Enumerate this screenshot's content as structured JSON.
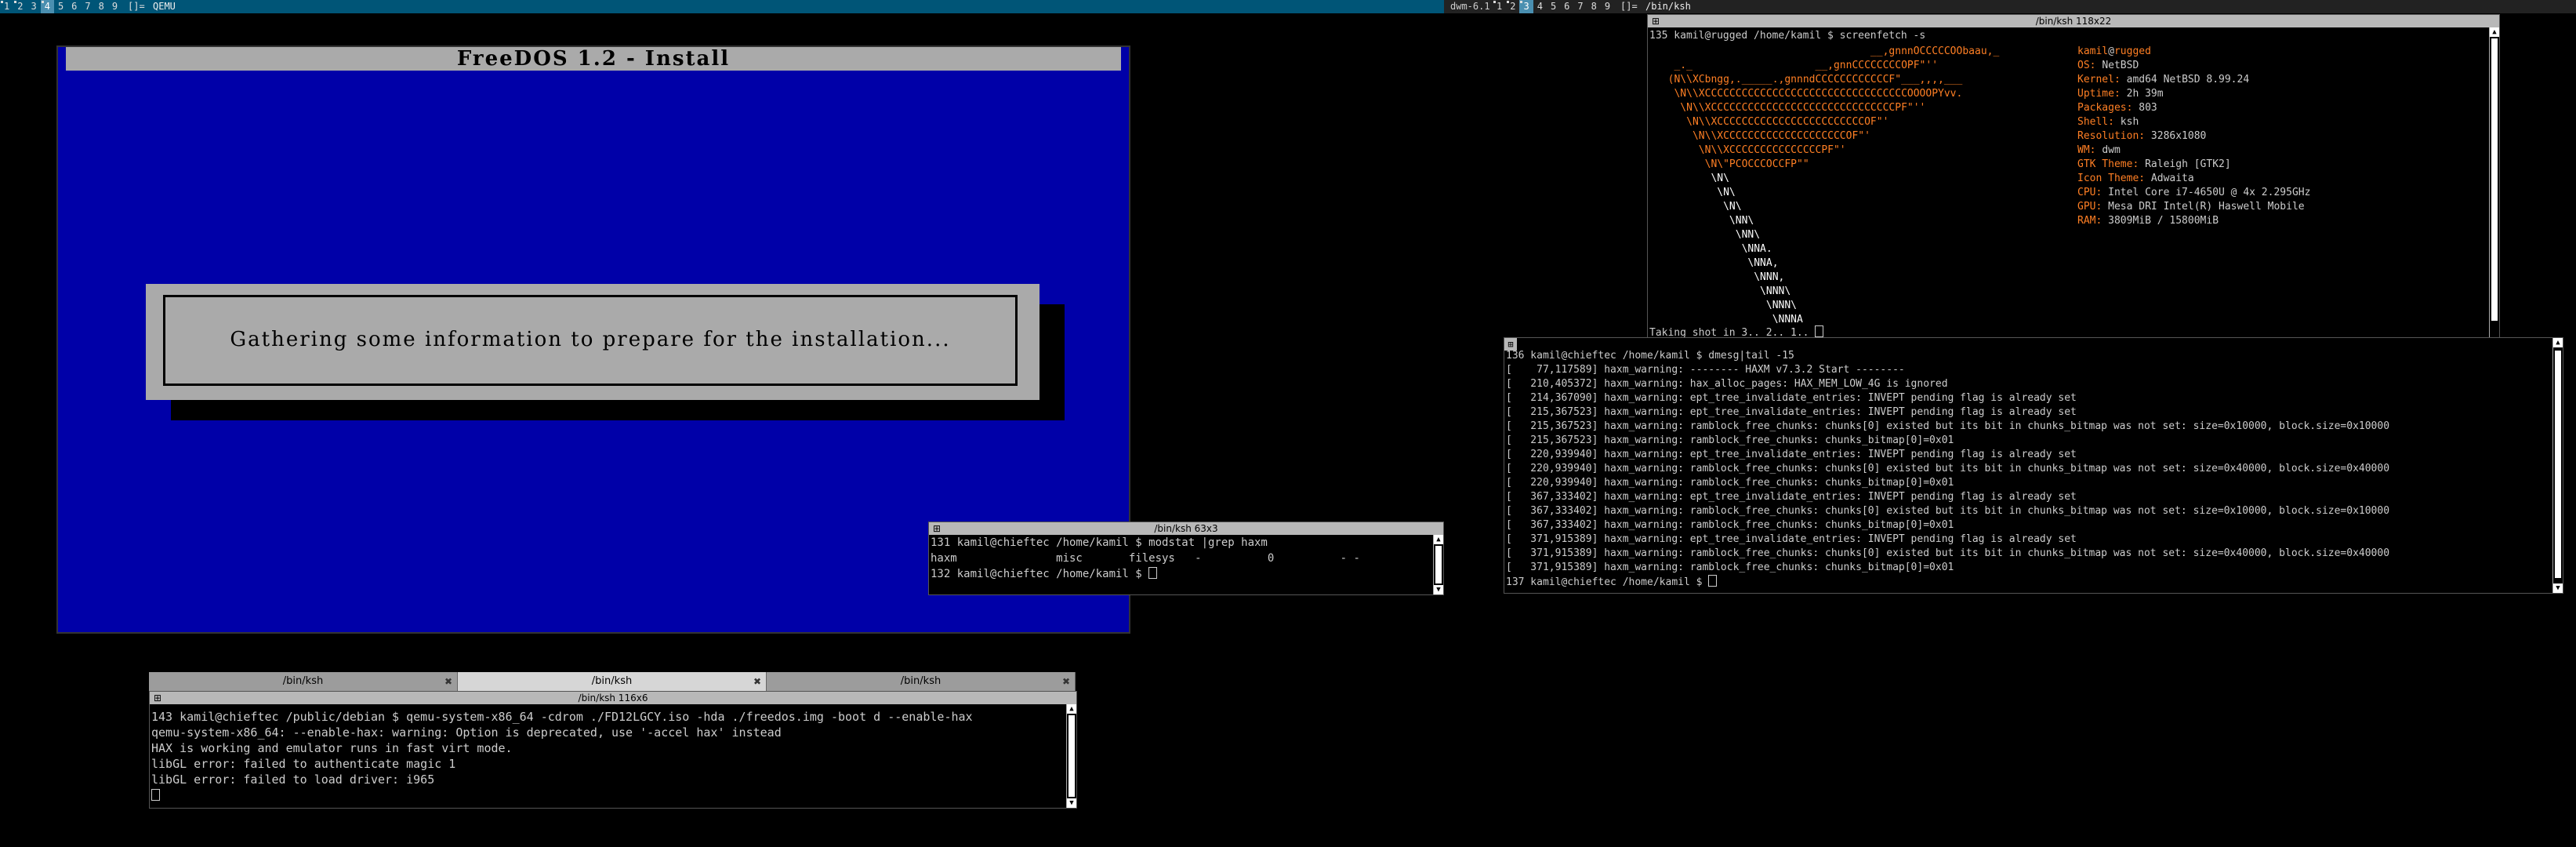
{
  "topbar_left": {
    "tags": [
      "1",
      "2",
      "3",
      "4",
      "5",
      "6",
      "7",
      "8",
      "9"
    ],
    "selected_tag": "4",
    "layout": "[]=",
    "title": "QEMU"
  },
  "topbar_right": {
    "status": "dwm-6.1",
    "tags": [
      "1",
      "2",
      "3",
      "4",
      "5",
      "6",
      "7",
      "8",
      "9"
    ],
    "selected_tag": "3",
    "layout": "[]=",
    "title": "/bin/ksh"
  },
  "qemu": {
    "title": "FreeDOS 1.2 - Install",
    "message": "Gathering some information to prepare for the installation..."
  },
  "screenfetch_window": {
    "title": "/bin/ksh 118x22",
    "prompt": "135 kamil@rugged /home/kamil $ screenfetch -s",
    "logo": [
      "                                   __,gnnnOCCCCCOObaau,_",
      "   _._                    __,gnnCCCCCCCCOPF\"''",
      "  (N\\\\XCbngg,._____.,gnnndCCCCCCCCCCCCF\"___,,,,___",
      "   \\N\\\\XCCCCCCCCCCCCCCCCCCCCCCCCCCCCCCCCCOOOOPYvv.",
      "    \\N\\\\XCCCCCCCCCCCCCCCCCCCCCCCCCCCCCCPF\"''",
      "     \\N\\\\XCCCCCCCCCCCCCCCCCCCCCCCCOF\"'",
      "      \\N\\\\XCCCCCCCCCCCCCCCCCCCCOF\"'",
      "       \\N\\\\XCCCCCCCCCCCCCCCPF\"'",
      "        \\N\\\"PCOCCCOCCFP\"\"",
      "         \\N\\",
      "          \\N\\",
      "           \\N\\",
      "            \\NN\\",
      "             \\NN\\",
      "              \\NNA.",
      "               \\NNA,",
      "                \\NNN,",
      "                 \\NNN\\",
      "                  \\NNN\\",
      "                   \\NNNA"
    ],
    "info": [
      {
        "key": "kamil",
        "value": "rugged",
        "sep": "@"
      },
      {
        "key": "OS:",
        "value": "NetBSD"
      },
      {
        "key": "Kernel:",
        "value": "amd64 NetBSD 8.99.24"
      },
      {
        "key": "Uptime:",
        "value": "2h 39m"
      },
      {
        "key": "Packages:",
        "value": "803"
      },
      {
        "key": "Shell:",
        "value": "ksh"
      },
      {
        "key": "Resolution:",
        "value": "3286x1080"
      },
      {
        "key": "WM:",
        "value": "dwm"
      },
      {
        "key": "GTK Theme:",
        "value": "Raleigh [GTK2]"
      },
      {
        "key": "Icon Theme:",
        "value": "Adwaita"
      },
      {
        "key": "CPU:",
        "value": "Intel Core i7-4650U @ 4x 2.295GHz"
      },
      {
        "key": "GPU:",
        "value": "Mesa DRI Intel(R) Haswell Mobile"
      },
      {
        "key": "RAM:",
        "value": "3809MiB / 15800MiB"
      }
    ],
    "footer": "Taking shot in 3.. 2.. 1.. "
  },
  "dmesg_window": {
    "lines": [
      "136 kamil@chieftec /home/kamil $ dmesg|tail -15",
      "[    77,117589] haxm_warning: -------- HAXM v7.3.2 Start --------",
      "[   210,405372] haxm_warning: hax_alloc_pages: HAX_MEM_LOW_4G is ignored",
      "[   214,367090] haxm_warning: ept_tree_invalidate_entries: INVEPT pending flag is already set",
      "[   215,367523] haxm_warning: ept_tree_invalidate_entries: INVEPT pending flag is already set",
      "[   215,367523] haxm_warning: ramblock_free_chunks: chunks[0] existed but its bit in chunks_bitmap was not set: size=0x10000, block.size=0x10000",
      "[   215,367523] haxm_warning: ramblock_free_chunks: chunks_bitmap[0]=0x01",
      "[   220,939940] haxm_warning: ept_tree_invalidate_entries: INVEPT pending flag is already set",
      "[   220,939940] haxm_warning: ramblock_free_chunks: chunks[0] existed but its bit in chunks_bitmap was not set: size=0x40000, block.size=0x40000",
      "[   220,939940] haxm_warning: ramblock_free_chunks: chunks_bitmap[0]=0x01",
      "[   367,333402] haxm_warning: ept_tree_invalidate_entries: INVEPT pending flag is already set",
      "[   367,333402] haxm_warning: ramblock_free_chunks: chunks[0] existed but its bit in chunks_bitmap was not set: size=0x10000, block.size=0x10000",
      "[   367,333402] haxm_warning: ramblock_free_chunks: chunks_bitmap[0]=0x01",
      "[   371,915389] haxm_warning: ept_tree_invalidate_entries: INVEPT pending flag is already set",
      "[   371,915389] haxm_warning: ramblock_free_chunks: chunks[0] existed but its bit in chunks_bitmap was not set: size=0x40000, block.size=0x40000",
      "[   371,915389] haxm_warning: ramblock_free_chunks: chunks_bitmap[0]=0x01"
    ],
    "prompt": "137 kamil@chieftec /home/kamil $ "
  },
  "modstat_window": {
    "title": "/bin/ksh 63x3",
    "lines": [
      "131 kamil@chieftec /home/kamil $ modstat |grep haxm",
      "haxm               misc       filesys   -          0          - -"
    ],
    "prompt": "132 kamil@chieftec /home/kamil $ "
  },
  "qemu_terminal": {
    "tabs": [
      "/bin/ksh",
      "/bin/ksh",
      "/bin/ksh"
    ],
    "active_tab": 1,
    "title": "/bin/ksh 116x6",
    "lines": [
      "143 kamil@chieftec /public/debian $ qemu-system-x86_64 -cdrom ./FD12LGCY.iso -hda ./freedos.img -boot d --enable-hax",
      "qemu-system-x86_64: --enable-hax: warning: Option is deprecated, use '-accel hax' instead",
      "HAX is working and emulator runs in fast virt mode.",
      "libGL error: failed to authenticate magic 1",
      "libGL error: failed to load driver: i965"
    ]
  },
  "colors": {
    "bar_active": "#005577",
    "dos_blue": "#0000a8",
    "dos_gray": "#aaaaaa",
    "screenfetch_accent": "#ff7f24"
  }
}
